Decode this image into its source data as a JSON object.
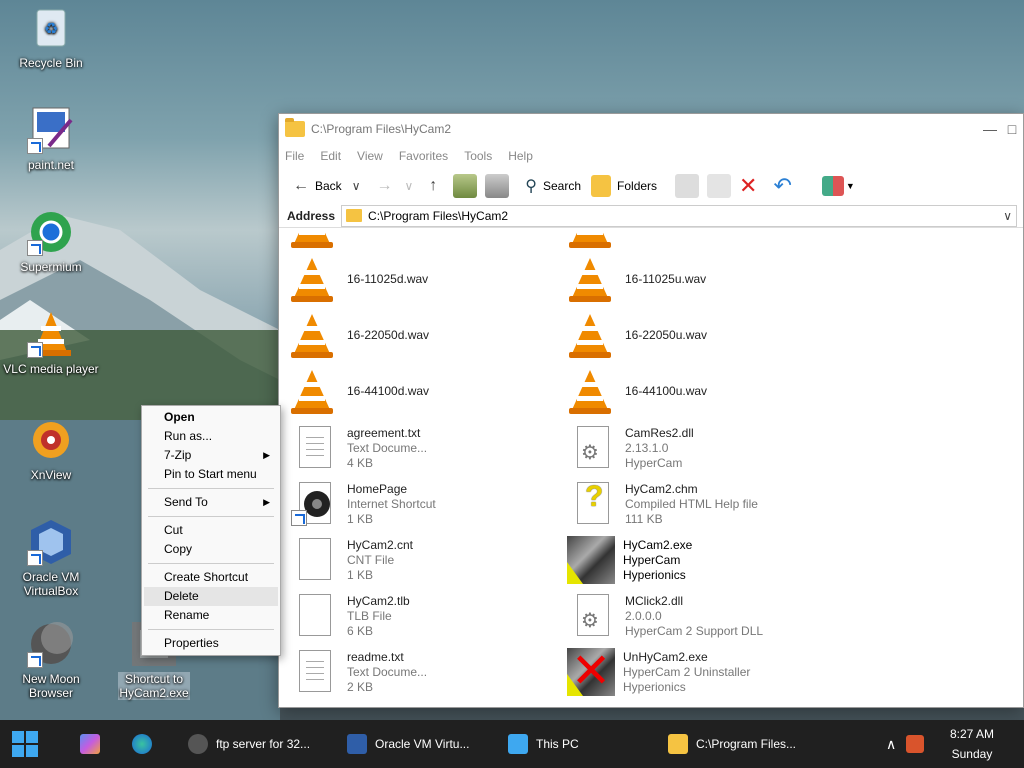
{
  "desktop": {
    "icons": [
      {
        "label": "Recycle Bin"
      },
      {
        "label": "paint.net"
      },
      {
        "label": "Supermium"
      },
      {
        "label": "VLC media player"
      },
      {
        "label": "XnView"
      },
      {
        "label": "Oracle VM VirtualBox"
      },
      {
        "label": "New Moon Browser"
      },
      {
        "label": "Shortcut to HyCam2.exe"
      }
    ]
  },
  "window": {
    "title": "C:\\Program Files\\HyCam2",
    "menu": [
      "File",
      "Edit",
      "View",
      "Favorites",
      "Tools",
      "Help"
    ],
    "toolbar": {
      "back": "Back",
      "search": "Search",
      "folders": "Folders"
    },
    "address_label": "Address",
    "address_value": "C:\\Program Files\\HyCam2",
    "files": [
      {
        "name": "16-11025d.wav",
        "type": "",
        "size": "",
        "icon": "vlc-cone"
      },
      {
        "name": "16-11025u.wav",
        "type": "",
        "size": "",
        "icon": "vlc-cone"
      },
      {
        "name": "16-22050d.wav",
        "type": "",
        "size": "",
        "icon": "vlc-cone"
      },
      {
        "name": "16-22050u.wav",
        "type": "",
        "size": "",
        "icon": "vlc-cone"
      },
      {
        "name": "16-44100d.wav",
        "type": "",
        "size": "",
        "icon": "vlc-cone"
      },
      {
        "name": "16-44100u.wav",
        "type": "",
        "size": "",
        "icon": "vlc-cone"
      },
      {
        "name": "agreement.txt",
        "type": "Text Docume...",
        "size": "4 KB",
        "icon": "text-doc"
      },
      {
        "name": "CamRes2.dll",
        "type": "2.13.1.0",
        "size": "HyperCam",
        "icon": "dll-gear"
      },
      {
        "name": "HomePage",
        "type": "Internet Shortcut",
        "size": "1 KB",
        "icon": "internet-shortcut"
      },
      {
        "name": "HyCam2.chm",
        "type": "Compiled HTML Help file",
        "size": "111 KB",
        "icon": "help-file"
      },
      {
        "name": "HyCam2.cnt",
        "type": "CNT File",
        "size": "1 KB",
        "icon": "blank-doc"
      },
      {
        "name": "HyCam2.exe",
        "type": "HyperCam",
        "size": "Hyperionics",
        "icon": "hypercam-exe"
      },
      {
        "name": "HyCam2.tlb",
        "type": "TLB File",
        "size": "6 KB",
        "icon": "blank-doc"
      },
      {
        "name": "MClick2.dll",
        "type": "2.0.0.0",
        "size": "HyperCam 2 Support DLL",
        "icon": "dll-gear"
      },
      {
        "name": "readme.txt",
        "type": "Text Docume...",
        "size": "2 KB",
        "icon": "text-doc"
      },
      {
        "name": "UnHyCam2.exe",
        "type": "HyperCam 2 Uninstaller",
        "size": "Hyperionics",
        "icon": "uninstaller-exe"
      }
    ]
  },
  "context_menu": {
    "items": [
      "Open",
      "Run as...",
      "7-Zip",
      "Pin to Start menu",
      "Send To",
      "Cut",
      "Copy",
      "Create Shortcut",
      "Delete",
      "Rename",
      "Properties"
    ]
  },
  "taskbar": {
    "items": [
      "ftp server for 32...",
      "Oracle VM Virtu...",
      "This PC",
      "C:\\Program Files..."
    ],
    "time": "8:27 AM",
    "day": "Sunday"
  }
}
